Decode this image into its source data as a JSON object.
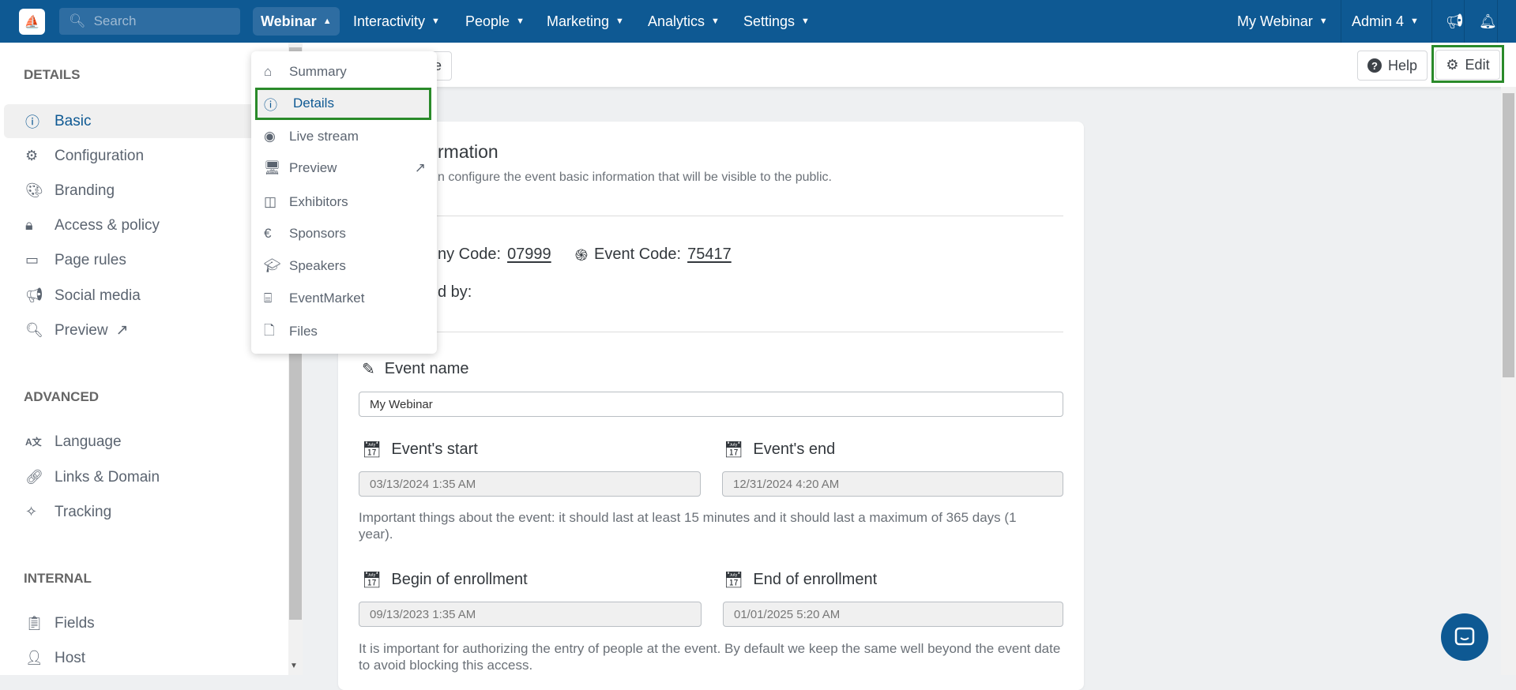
{
  "nav": {
    "search_placeholder": "Search",
    "items": [
      {
        "label": "Webinar",
        "active": true
      },
      {
        "label": "Interactivity"
      },
      {
        "label": "People"
      },
      {
        "label": "Marketing"
      },
      {
        "label": "Analytics"
      },
      {
        "label": "Settings"
      }
    ],
    "event_selector": "My Webinar",
    "user": "Admin 4",
    "icons": [
      "megaphone-icon",
      "bell-icon"
    ],
    "brand_color": "#0e5993"
  },
  "webinar_menu": {
    "items": [
      {
        "label": "Summary",
        "icon": "home-icon"
      },
      {
        "label": "Details",
        "icon": "info-circle-icon",
        "active": true
      },
      {
        "label": "Live stream",
        "icon": "podcast-icon"
      },
      {
        "label": "Preview",
        "icon": "monitor-icon",
        "external": true
      },
      {
        "label": "Exhibitors",
        "icon": "booth-icon"
      },
      {
        "label": "Sponsors",
        "icon": "euro-icon"
      },
      {
        "label": "Speakers",
        "icon": "graduation-cap-icon"
      },
      {
        "label": "EventMarket",
        "icon": "store-icon"
      },
      {
        "label": "Files",
        "icon": "file-icon"
      }
    ]
  },
  "toolbar": {
    "hidden_button_fragment": "e",
    "help": "Help",
    "edit": "Edit"
  },
  "sidebar": {
    "sections": [
      {
        "title": "DETAILS",
        "items": [
          {
            "label": "Basic",
            "icon": "info-circle-icon",
            "active": true
          },
          {
            "label": "Configuration",
            "icon": "gear-icon"
          },
          {
            "label": "Branding",
            "icon": "palette-icon"
          },
          {
            "label": "Access & policy",
            "icon": "lock-icon"
          },
          {
            "label": "Page rules",
            "icon": "window-icon"
          },
          {
            "label": "Social media",
            "icon": "megaphone-icon"
          },
          {
            "label": "Preview",
            "icon": "search-icon",
            "external": true
          }
        ]
      },
      {
        "title": "ADVANCED",
        "items": [
          {
            "label": "Language",
            "icon": "language-icon"
          },
          {
            "label": "Links & Domain",
            "icon": "link-icon"
          },
          {
            "label": "Tracking",
            "icon": "magic-wand-icon"
          }
        ]
      },
      {
        "title": "INTERNAL",
        "items": [
          {
            "label": "Fields",
            "icon": "clipboard-icon"
          },
          {
            "label": "Host",
            "icon": "user-icon"
          }
        ]
      }
    ]
  },
  "card": {
    "title_fragment": "rmation",
    "subtitle_fragment": "n configure the event basic information that will be visible to the public.",
    "company_code_label_fragment": "ny Code:",
    "company_code": "07999",
    "event_code_label": "Event Code:",
    "event_code": "75417",
    "created_by_fragment": "d by:",
    "event_name_label": "Event name",
    "event_name_value": "My Webinar",
    "start_label": "Event's start",
    "start_value": "03/13/2024 1:35 AM",
    "end_label": "Event's end",
    "end_value": "12/31/2024 4:20 AM",
    "event_help": "Important things about the event: it should last at least 15 minutes and it should last a maximum of 365 days (1 year).",
    "enroll_begin_label": "Begin of enrollment",
    "enroll_begin_value": "09/13/2023 1:35 AM",
    "enroll_end_label": "End of enrollment",
    "enroll_end_value": "01/01/2025 5:20 AM",
    "enroll_help": "It is important for authorizing the entry of people at the event. By default we keep the same well beyond the event date to avoid blocking this access."
  }
}
